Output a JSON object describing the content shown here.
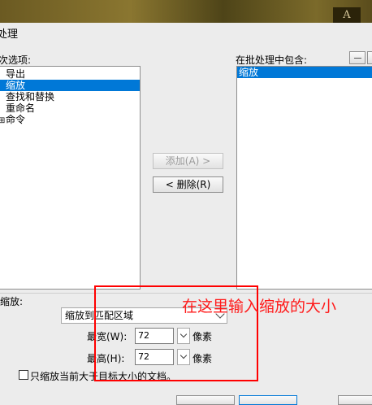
{
  "window": {
    "title": "处理"
  },
  "left_panel": {
    "label": "次选项:",
    "items": [
      {
        "label": "导出",
        "selected": false,
        "expandable": false
      },
      {
        "label": "缩放",
        "selected": true,
        "expandable": false
      },
      {
        "label": "查找和替换",
        "selected": false,
        "expandable": false
      },
      {
        "label": "重命名",
        "selected": false,
        "expandable": false
      },
      {
        "label": "命令",
        "selected": false,
        "expandable": true
      }
    ]
  },
  "middle_buttons": {
    "add_label": "添加(A) >",
    "remove_label": "< 删除(R)"
  },
  "right_panel": {
    "label": "在批处理中包含:",
    "items": [
      {
        "label": "缩放",
        "selected": true
      }
    ]
  },
  "scale_section": {
    "label": "缩放:",
    "mode": "缩放到匹配区域",
    "max_width_label": "最宽(W):",
    "max_width_value": "72",
    "max_height_label": "最高(H):",
    "max_height_value": "72",
    "unit_label": "像素",
    "checkbox_label": "只缩放当前大于目标大小的文档。",
    "checkbox_checked": false
  },
  "annotation": {
    "text": "在这里输入缩放的大小",
    "color": "#ff1a1a"
  },
  "colors": {
    "selection": "#0078d7",
    "annotation": "#ff0000"
  }
}
